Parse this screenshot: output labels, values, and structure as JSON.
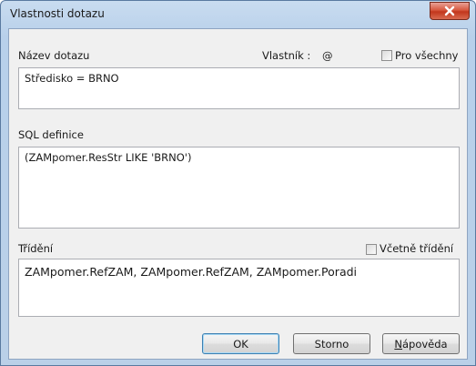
{
  "window": {
    "title": "Vlastnosti dotazu"
  },
  "query_name": {
    "label": "Název dotazu",
    "owner_label": "Vlastník :",
    "owner_value": "@",
    "for_all_label": "Pro všechny",
    "for_all_checked": false,
    "value": "Středisko = BRNO"
  },
  "sql": {
    "label": "SQL definice",
    "value": "(ZAMpomer.ResStr LIKE 'BRNO')"
  },
  "sort": {
    "label": "Třídění",
    "include_sort_label": "Včetně třídění",
    "include_sort_checked": false,
    "value": "ZAMpomer.RefZAM, ZAMpomer.RefZAM, ZAMpomer.Poradi"
  },
  "buttons": {
    "ok": "OK",
    "cancel": "Storno",
    "help": "Nápověda"
  },
  "colors": {
    "close_button": "#c2361c",
    "default_button_border": "#3c7fb1"
  },
  "icons": {
    "close": "close-icon"
  }
}
